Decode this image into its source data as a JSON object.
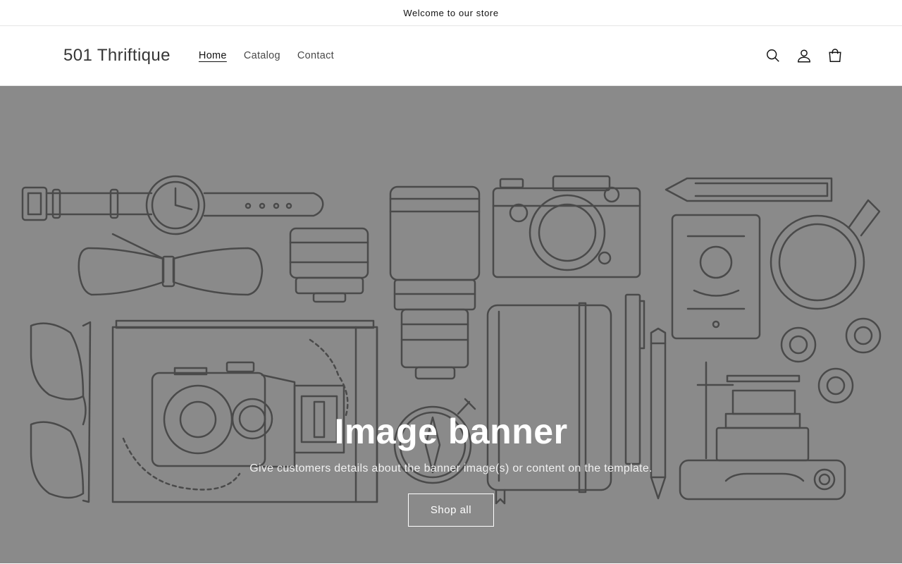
{
  "announcement": {
    "text": "Welcome to our store"
  },
  "header": {
    "logo": "501 Thriftique",
    "nav": [
      {
        "label": "Home",
        "active": true
      },
      {
        "label": "Catalog",
        "active": false
      },
      {
        "label": "Contact",
        "active": false
      }
    ],
    "icons": [
      "search-icon",
      "account-icon",
      "cart-icon"
    ]
  },
  "banner": {
    "title": "Image banner",
    "text": "Give customers details about the banner image(s) or content on the template.",
    "button_label": "Shop all",
    "background_color": "#8a8a8a",
    "line_color": "#4a4a4a"
  }
}
